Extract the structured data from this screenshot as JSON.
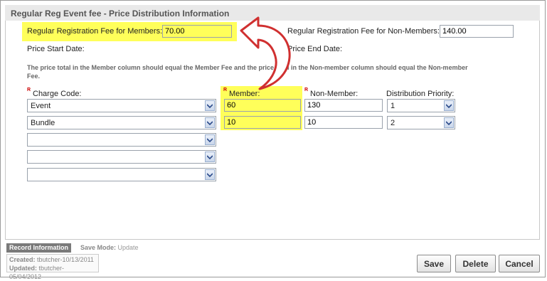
{
  "window": {
    "title": "Regular Reg Event fee - Price Distribution Information"
  },
  "fees": {
    "member_label": "Regular Registration Fee for Members:",
    "member_value": "70.00",
    "nonmember_label": "Regular Registration Fee for Non-Members:",
    "nonmember_value": "140.00",
    "start_date_label": "Price Start Date:",
    "end_date_label": "Price End Date:"
  },
  "note": "The price total in the Member column should equal the Member Fee and the price total in the Non-member column should equal the Non-member Fee.",
  "columns": {
    "required_marker": "R",
    "charge_code": "Charge Code:",
    "member": "Member:",
    "non_member": "Non-Member:",
    "priority": "Distribution Priority:"
  },
  "rows": [
    {
      "charge_code": "Event",
      "member": "60",
      "non_member": "130",
      "priority": "1"
    },
    {
      "charge_code": "Bundle",
      "member": "10",
      "non_member": "10",
      "priority": "2"
    },
    {
      "charge_code": ""
    },
    {
      "charge_code": ""
    },
    {
      "charge_code": ""
    }
  ],
  "record": {
    "tab_label": "Record Information",
    "save_mode_label": "Save Mode:",
    "save_mode_value": "Update",
    "created_label": "Created:",
    "created_value": "tbutcher-10/13/2011",
    "updated_label": "Updated:",
    "updated_value": "tbutcher-05/04/2012"
  },
  "buttons": {
    "save": "Save",
    "delete": "Delete",
    "cancel": "Cancel"
  },
  "colors": {
    "highlight": "#ffff5a",
    "arrow_fill": "#ffffff",
    "arrow_stroke": "#d03030",
    "required": "#cc0000"
  },
  "icons": {
    "dropdown": "chevron-down-icon",
    "annotation": "curved-arrow-icon"
  }
}
